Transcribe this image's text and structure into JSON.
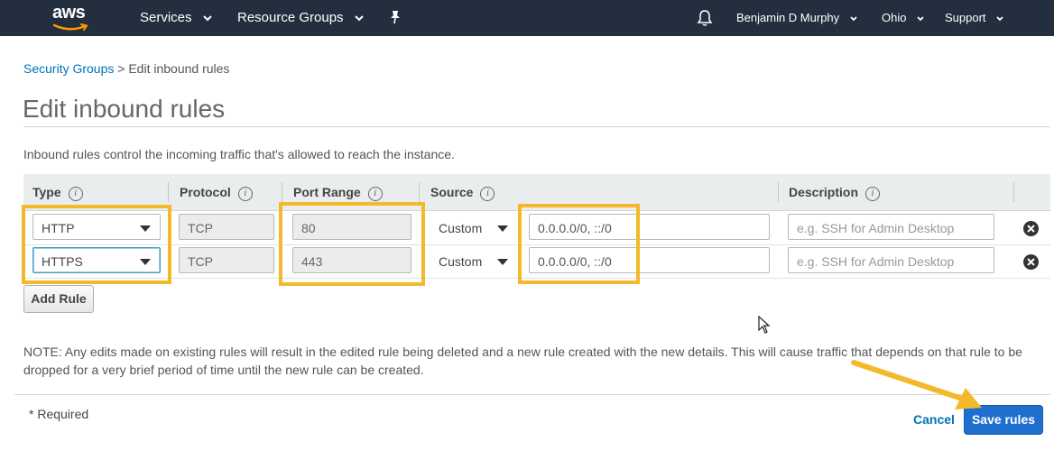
{
  "nav": {
    "logo_text": "aws",
    "services": "Services",
    "resource_groups": "Resource Groups",
    "user": "Benjamin D Murphy",
    "region": "Ohio",
    "support": "Support",
    "background": "#232f3e",
    "logo_smile_color": "#ff9900"
  },
  "breadcrumb": {
    "link": "Security Groups",
    "separator": " > ",
    "current": "Edit inbound rules"
  },
  "page_title": "Edit inbound rules",
  "intro": "Inbound rules control the incoming traffic that's allowed to reach the instance.",
  "columns": {
    "type": "Type",
    "protocol": "Protocol",
    "port_range": "Port Range",
    "source": "Source",
    "description": "Description",
    "info_glyph": "i"
  },
  "rules": [
    {
      "type": "HTTP",
      "protocol": "TCP",
      "port_range": "80",
      "source_mode": "Custom",
      "source_value": "0.0.0.0/0, ::/0",
      "description_placeholder": "e.g. SSH for Admin Desktop"
    },
    {
      "type": "HTTPS",
      "protocol": "TCP",
      "port_range": "443",
      "source_mode": "Custom",
      "source_value": "0.0.0.0/0, ::/0",
      "description_placeholder": "e.g. SSH for Admin Desktop"
    }
  ],
  "add_rule": "Add Rule",
  "note": "NOTE: Any edits made on existing rules will result in the edited rule being deleted and a new rule created with the new details. This will cause traffic that depends on that rule to be dropped for a very brief period of time until the new rule can be created.",
  "required": "* Required",
  "cancel": "Cancel",
  "save": "Save rules",
  "colors": {
    "highlight": "#f4b92b",
    "link": "#0073bb",
    "primary_button": "#1f6fcf",
    "table_header": "#eaeded"
  },
  "icons": [
    "bell-icon",
    "pin-icon",
    "info-icon",
    "remove-rule-icon",
    "chevron-down-icon",
    "mouse-cursor-icon",
    "annotation-arrow"
  ]
}
